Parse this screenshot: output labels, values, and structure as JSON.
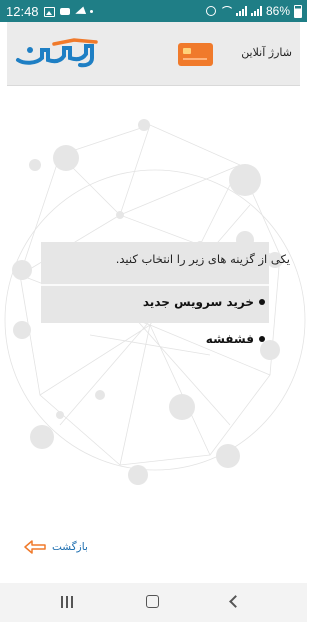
{
  "status_bar": {
    "time": "12:48",
    "battery": "86%"
  },
  "header": {
    "title": "شارژ آنلاین",
    "logo_text": "ماهان",
    "accent": "#f07a2b"
  },
  "panel": {
    "prompt": "یکی از گزینه های زیر را انتخاب کنید.",
    "options": [
      {
        "label": "خرید سرویس جدید"
      },
      {
        "label": "فشفشه"
      }
    ]
  },
  "back_link": {
    "label": "بازگشت"
  },
  "colors": {
    "status_bar": "#1f7e86",
    "header_bg": "#ebebeb",
    "panel_bg": "#e6e6e6",
    "link": "#1e6fb0",
    "back_arrow": "#f07a2b"
  }
}
